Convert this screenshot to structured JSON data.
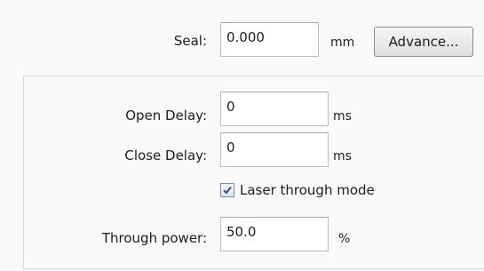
{
  "seal": {
    "label": "Seal:",
    "value": "0.000",
    "unit": "mm",
    "advance_button": "Advance..."
  },
  "open_delay": {
    "label": "Open Delay:",
    "value": "0",
    "unit": "ms"
  },
  "close_delay": {
    "label": "Close Delay:",
    "value": "0",
    "unit": "ms"
  },
  "laser_through_mode": {
    "label": "Laser through mode",
    "checked": true
  },
  "through_power": {
    "label": "Through power:",
    "value": "50.0",
    "unit": "%"
  }
}
